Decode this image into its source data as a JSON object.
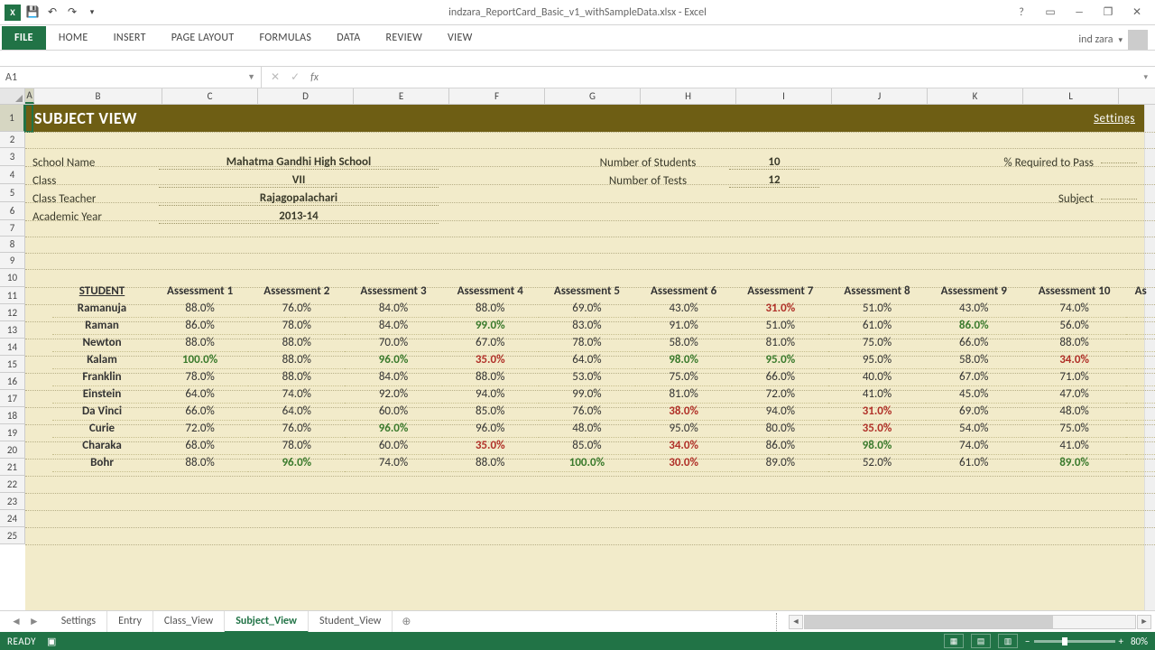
{
  "app": {
    "title": "indzara_ReportCard_Basic_v1_withSampleData.xlsx - Excel",
    "user": "ind zara"
  },
  "qat": {
    "undo": "↶",
    "redo": "↷"
  },
  "ribbon": {
    "file": "FILE",
    "tabs": [
      "HOME",
      "INSERT",
      "PAGE LAYOUT",
      "FORMULAS",
      "DATA",
      "REVIEW",
      "VIEW"
    ]
  },
  "formula_bar": {
    "name_box": "A1",
    "fx": "fx"
  },
  "columns": [
    "A",
    "B",
    "C",
    "D",
    "E",
    "F",
    "G",
    "H",
    "I",
    "J",
    "K",
    "L"
  ],
  "rows": [
    "1",
    "2",
    "3",
    "4",
    "5",
    "6",
    "7",
    "8",
    "9",
    "10",
    "11",
    "12",
    "13",
    "14",
    "15",
    "16",
    "17",
    "18",
    "19",
    "20",
    "21",
    "22",
    "23",
    "24",
    "25"
  ],
  "banner": {
    "title": "SUBJECT VIEW",
    "settings": "Settings"
  },
  "info_left": {
    "school_label": "School Name",
    "school": "Mahatma Gandhi High School",
    "class_label": "Class",
    "class": "VII",
    "teacher_label": "Class Teacher",
    "teacher": "Rajagopalachari",
    "year_label": "Academic Year",
    "year": "2013-14"
  },
  "info_mid": {
    "students_label": "Number of Students",
    "students": "10",
    "tests_label": "Number of Tests",
    "tests": "12"
  },
  "info_right": {
    "pass_label": "% Required to Pass",
    "subject_label": "Subject"
  },
  "headers": [
    "STUDENT",
    "Assessment 1",
    "Assessment 2",
    "Assessment 3",
    "Assessment 4",
    "Assessment 5",
    "Assessment 6",
    "Assessment 7",
    "Assessment 8",
    "Assessment 9",
    "Assessment 10",
    "As"
  ],
  "students": [
    {
      "name": "Ramanuja",
      "v": [
        "88.0%",
        "76.0%",
        "84.0%",
        "88.0%",
        "69.0%",
        "43.0%",
        "31.0%",
        "51.0%",
        "43.0%",
        "74.0%"
      ],
      "hi": {
        "6": "red"
      }
    },
    {
      "name": "Raman",
      "v": [
        "86.0%",
        "78.0%",
        "84.0%",
        "99.0%",
        "83.0%",
        "91.0%",
        "51.0%",
        "61.0%",
        "86.0%",
        "56.0%"
      ],
      "hi": {
        "3": "green",
        "8": "green"
      }
    },
    {
      "name": "Newton",
      "v": [
        "88.0%",
        "88.0%",
        "70.0%",
        "67.0%",
        "78.0%",
        "58.0%",
        "81.0%",
        "75.0%",
        "66.0%",
        "88.0%"
      ],
      "hi": {}
    },
    {
      "name": "Kalam",
      "v": [
        "100.0%",
        "88.0%",
        "96.0%",
        "35.0%",
        "64.0%",
        "98.0%",
        "95.0%",
        "95.0%",
        "58.0%",
        "34.0%"
      ],
      "hi": {
        "0": "green",
        "2": "green",
        "3": "red",
        "5": "green",
        "6": "green",
        "9": "red"
      }
    },
    {
      "name": "Franklin",
      "v": [
        "78.0%",
        "88.0%",
        "84.0%",
        "88.0%",
        "53.0%",
        "75.0%",
        "66.0%",
        "40.0%",
        "67.0%",
        "71.0%"
      ],
      "hi": {}
    },
    {
      "name": "Einstein",
      "v": [
        "64.0%",
        "74.0%",
        "92.0%",
        "94.0%",
        "99.0%",
        "81.0%",
        "72.0%",
        "41.0%",
        "45.0%",
        "47.0%"
      ],
      "hi": {}
    },
    {
      "name": "Da Vinci",
      "v": [
        "66.0%",
        "64.0%",
        "60.0%",
        "85.0%",
        "76.0%",
        "38.0%",
        "94.0%",
        "31.0%",
        "69.0%",
        "48.0%"
      ],
      "hi": {
        "5": "red",
        "7": "red"
      }
    },
    {
      "name": "Curie",
      "v": [
        "72.0%",
        "76.0%",
        "96.0%",
        "96.0%",
        "48.0%",
        "95.0%",
        "80.0%",
        "35.0%",
        "54.0%",
        "75.0%"
      ],
      "hi": {
        "2": "green",
        "7": "red"
      }
    },
    {
      "name": "Charaka",
      "v": [
        "68.0%",
        "78.0%",
        "60.0%",
        "35.0%",
        "85.0%",
        "34.0%",
        "86.0%",
        "98.0%",
        "74.0%",
        "41.0%"
      ],
      "hi": {
        "3": "red",
        "5": "red",
        "7": "green"
      }
    },
    {
      "name": "Bohr",
      "v": [
        "88.0%",
        "96.0%",
        "74.0%",
        "88.0%",
        "100.0%",
        "30.0%",
        "89.0%",
        "52.0%",
        "61.0%",
        "89.0%"
      ],
      "hi": {
        "1": "green",
        "4": "green",
        "5": "red",
        "9": "green"
      }
    }
  ],
  "sheet_tabs": [
    "Settings",
    "Entry",
    "Class_View",
    "Subject_View",
    "Student_View"
  ],
  "active_sheet": 3,
  "status": {
    "ready": "READY",
    "zoom": "80%"
  }
}
